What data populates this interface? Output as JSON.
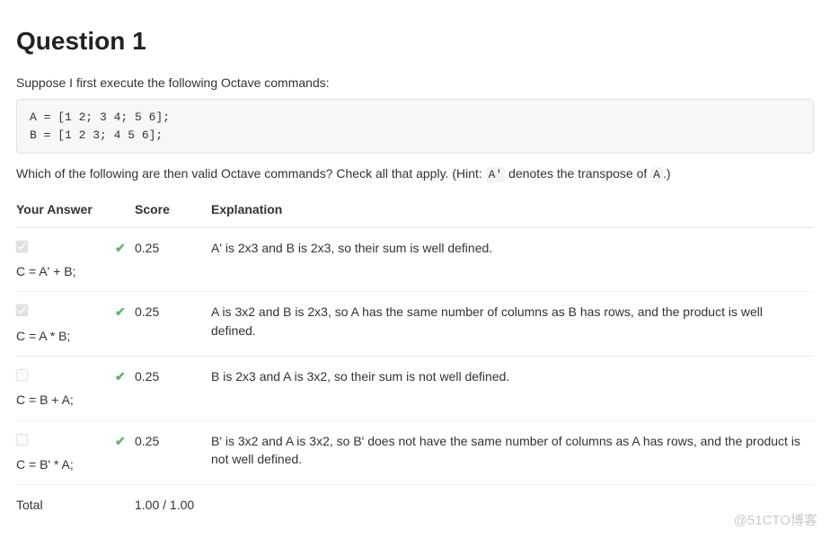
{
  "title": "Question 1",
  "prompt_intro": "Suppose I first execute the following Octave commands:",
  "code": "A = [1 2; 3 4; 5 6];\nB = [1 2 3; 4 5 6];",
  "subprompt_pre": "Which of the following are then valid Octave commands? Check all that apply. (Hint: ",
  "code_a_prime": "A'",
  "subprompt_mid": " denotes the transpose of ",
  "code_a": "A",
  "subprompt_post": ".)",
  "headers": {
    "answer": "Your Answer",
    "score": "Score",
    "explanation": "Explanation"
  },
  "rows": [
    {
      "checked": true,
      "answer": "C = A' + B;",
      "correct": true,
      "score": "0.25",
      "explanation": "A' is 2x3 and B is 2x3, so their sum is well defined."
    },
    {
      "checked": true,
      "answer": "C = A * B;",
      "correct": true,
      "score": "0.25",
      "explanation": "A is 3x2 and B is 2x3, so A has the same number of columns as B has rows, and the product is well defined."
    },
    {
      "checked": false,
      "answer": "C = B + A;",
      "correct": true,
      "score": "0.25",
      "explanation": "B is 2x3 and A is 3x2, so their sum is not well defined."
    },
    {
      "checked": false,
      "answer": "C = B' * A;",
      "correct": true,
      "score": "0.25",
      "explanation": "B' is 3x2 and A is 3x2, so B' does not have the same number of columns as A has rows, and the product is not well defined."
    }
  ],
  "total": {
    "label": "Total",
    "score": "1.00 / 1.00"
  },
  "watermark": "@51CTO博客"
}
